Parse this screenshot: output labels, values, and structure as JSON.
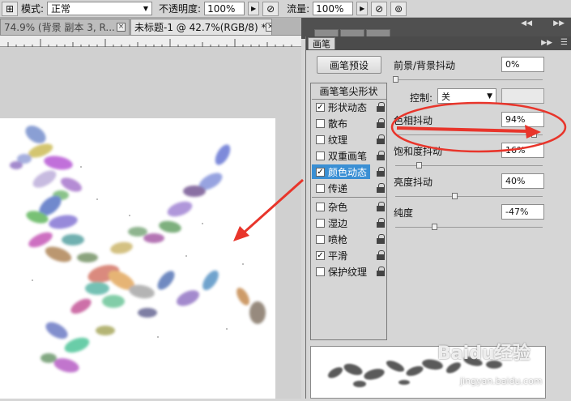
{
  "options_bar": {
    "mode_label": "模式:",
    "mode_value": "正常",
    "opacity_label": "不透明度:",
    "opacity_value": "100%",
    "flow_label": "流量:",
    "flow_value": "100%"
  },
  "doc_tabs": [
    {
      "label": "74.9% (背景 副本 3, R..."
    },
    {
      "label": "未标题-1 @ 42.7%(RGB/8) *"
    }
  ],
  "brush_panel": {
    "title": "画笔",
    "preset_button": "画笔预设",
    "list_header": "画笔笔尖形状",
    "items": [
      {
        "label": "形状动态",
        "checked": true
      },
      {
        "label": "散布",
        "checked": false
      },
      {
        "label": "纹理",
        "checked": false
      },
      {
        "label": "双重画笔",
        "checked": false
      },
      {
        "label": "颜色动态",
        "checked": true,
        "selected": true
      },
      {
        "label": "传递",
        "checked": false
      },
      {
        "label": "杂色",
        "checked": false
      },
      {
        "label": "湿边",
        "checked": false
      },
      {
        "label": "喷枪",
        "checked": false
      },
      {
        "label": "平滑",
        "checked": true
      },
      {
        "label": "保护纹理",
        "checked": false
      }
    ],
    "fg_bg_jitter_label": "前景/背景抖动",
    "fg_bg_jitter_value": "0%",
    "control_label": "控制:",
    "control_value": "关",
    "hue_jitter_label": "色相抖动",
    "hue_jitter_value": "94%",
    "saturation_jitter_label": "饱和度抖动",
    "saturation_jitter_value": "16%",
    "brightness_jitter_label": "亮度抖动",
    "brightness_jitter_value": "40%",
    "purity_label": "纯度",
    "purity_value": "-47%"
  },
  "watermark": {
    "text": "Baidu经验",
    "sub": "jingyan.baidu.com"
  },
  "colors": {
    "accent_red": "#e8352b",
    "selection_blue": "#3a8fd4"
  }
}
